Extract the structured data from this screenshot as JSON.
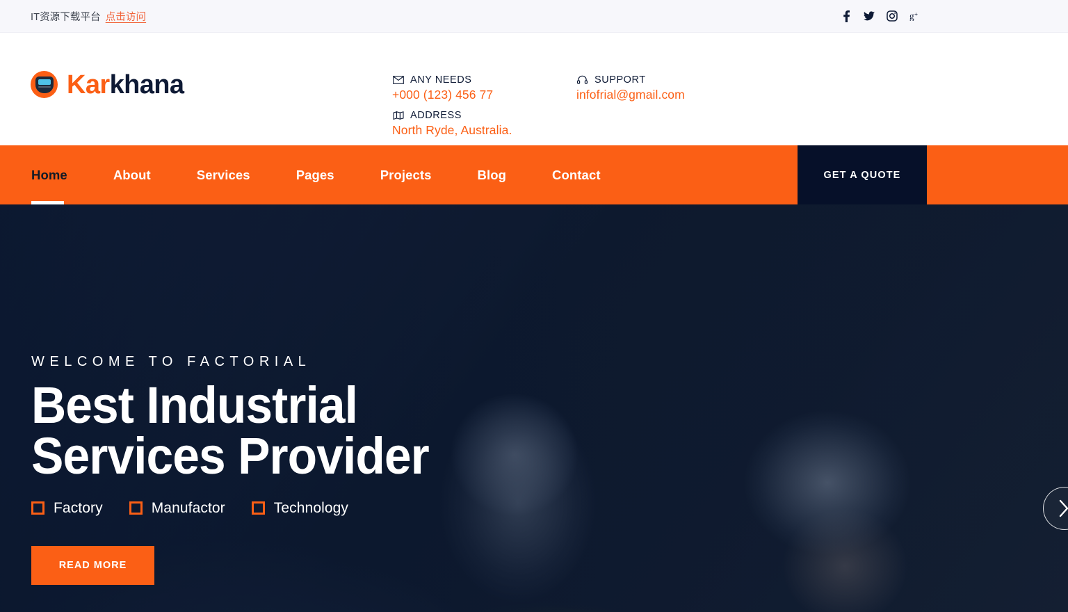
{
  "topbar": {
    "notice_text": "IT资源下载平台",
    "notice_link": "点击访问",
    "socials": [
      {
        "name": "facebook-icon",
        "glyph": "f"
      },
      {
        "name": "twitter-icon",
        "glyph": "t"
      },
      {
        "name": "instagram-icon",
        "glyph": "i"
      },
      {
        "name": "googleplus-icon",
        "glyph": "g+"
      }
    ]
  },
  "header": {
    "brand_first": "Kar",
    "brand_second": "khana",
    "contacts": [
      {
        "label": "ANY NEEDS",
        "value": "+000 (123) 456 77",
        "icon": "envelope-icon"
      },
      {
        "label": "ADDRESS",
        "value": "North Ryde, Australia.",
        "icon": "map-icon"
      },
      {
        "label": "SUPPORT",
        "value": "infofrial@gmail.com",
        "icon": "headset-icon"
      }
    ]
  },
  "nav": {
    "items": [
      {
        "label": "Home",
        "active": true
      },
      {
        "label": "About",
        "active": false
      },
      {
        "label": "Services",
        "active": false
      },
      {
        "label": "Pages",
        "active": false
      },
      {
        "label": "Projects",
        "active": false
      },
      {
        "label": "Blog",
        "active": false
      },
      {
        "label": "Contact",
        "active": false
      }
    ],
    "quote_label": "GET A QUOTE"
  },
  "hero": {
    "kicker": "WELCOME TO FACTORIAL",
    "title_line1": "Best Industrial",
    "title_line2": "Services Provider",
    "features": [
      "Factory",
      "Manufactor",
      "Technology"
    ],
    "cta_label": "READ MORE"
  },
  "colors": {
    "accent_orange": "#fb5f15",
    "dark_navy": "#0e1a35",
    "quote_bg": "#061029",
    "topbar_bg": "#f7f7fb",
    "link_orange": "#f2633a"
  }
}
